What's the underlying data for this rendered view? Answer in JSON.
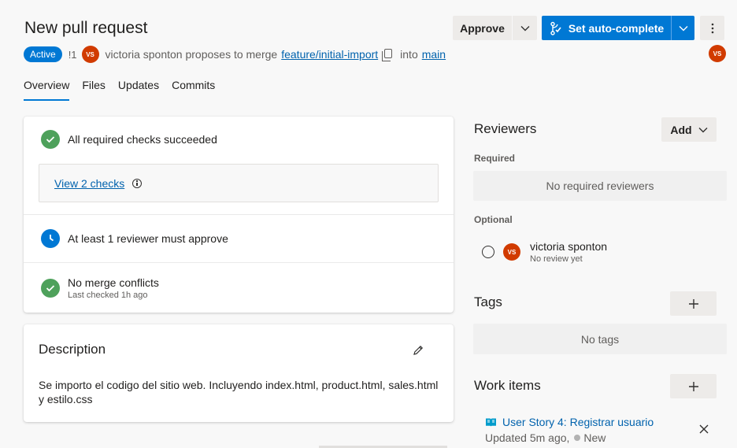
{
  "header": {
    "title": "New pull request",
    "status_badge": "Active",
    "pr_id": "!1",
    "author_initials": "VS",
    "proposal_text": "victoria sponton proposes to merge",
    "source_branch": "feature/initial-import",
    "into_text": "into",
    "target_branch": "main"
  },
  "actions": {
    "approve_label": "Approve",
    "autocomplete_label": "Set auto-complete",
    "user_initials": "VS"
  },
  "tabs": [
    {
      "label": "Overview",
      "active": true
    },
    {
      "label": "Files",
      "active": false
    },
    {
      "label": "Updates",
      "active": false
    },
    {
      "label": "Commits",
      "active": false
    }
  ],
  "checks": {
    "required_checks": "All required checks succeeded",
    "view_checks": "View 2 checks",
    "reviewer_policy": "At least 1 reviewer must approve",
    "merge_conflicts": "No merge conflicts",
    "last_checked": "Last checked 1h ago"
  },
  "description": {
    "title": "Description",
    "text": "Se importo el codigo del sitio web. Incluyendo index.html, product.html, sales.html y estilo.css"
  },
  "reviewers": {
    "title": "Reviewers",
    "add_label": "Add",
    "required_label": "Required",
    "no_required": "No required reviewers",
    "optional_label": "Optional",
    "optional_reviewers": [
      {
        "initials": "VS",
        "name": "victoria sponton",
        "status": "No review yet"
      }
    ]
  },
  "tags": {
    "title": "Tags",
    "empty": "No tags"
  },
  "work_items": {
    "title": "Work items",
    "items": [
      {
        "title": "User Story 4: Registrar usuario",
        "updated": "Updated 5m ago,",
        "state": "New"
      }
    ]
  },
  "colors": {
    "accent": "#0078d4",
    "success": "#4ea15b",
    "avatar": "#d13b00"
  }
}
